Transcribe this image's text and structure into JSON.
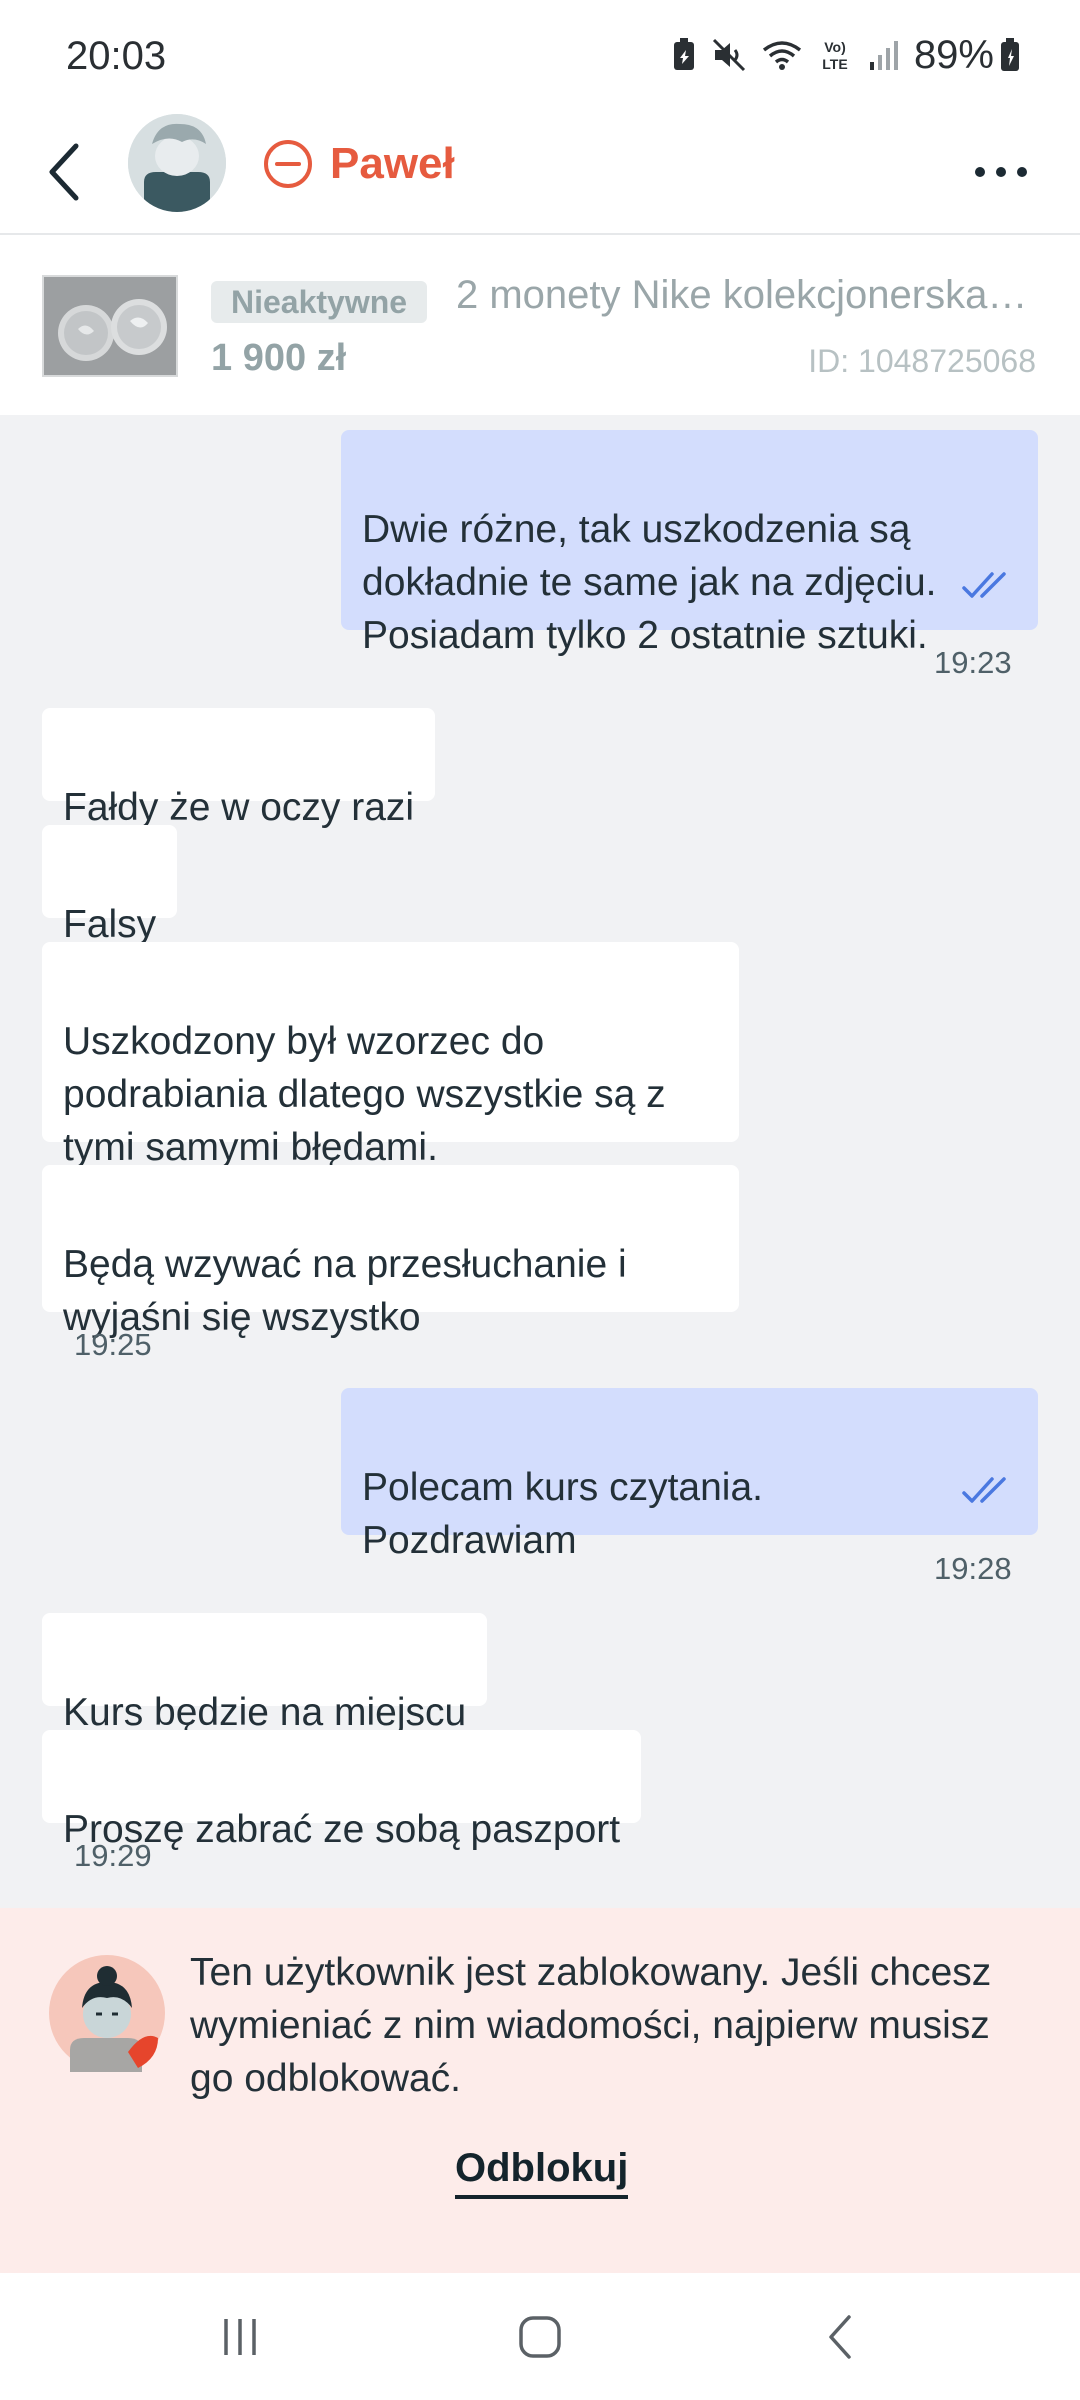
{
  "status_bar": {
    "time": "20:03",
    "battery": "89%",
    "icons": [
      "battery-saver-icon",
      "mute-icon",
      "wifi-icon",
      "volte-icon",
      "signal-icon",
      "battery-icon"
    ]
  },
  "header": {
    "contact_name": "Paweł",
    "back_icon": "chevron-left-icon",
    "status_icon": "blocked-icon",
    "menu_icon": "more-horizontal-icon",
    "accent_color": "#e65b3f"
  },
  "item": {
    "status": "Nieaktywne",
    "title": "2 monety Nike kolekcjonerska 1…",
    "price": "1 900 zł",
    "id": "ID: 1048725068"
  },
  "messages": [
    {
      "direction": "out",
      "text": "Dwie różne, tak uszkodzenia są\ndokładnie te same jak na zdjęciu.\nPosiadam tylko 2 ostatnie sztuki.",
      "read": true
    },
    {
      "direction": "out",
      "time": "19:23"
    },
    {
      "direction": "in",
      "text": "Fałdy że w oczy razi"
    },
    {
      "direction": "in",
      "text": "Falsy"
    },
    {
      "direction": "in",
      "text": "Uszkodzony był wzorzec do\npodrabiania dlatego wszystkie są z\ntymi samymi błędami."
    },
    {
      "direction": "in",
      "text": "Będą wzywać na przesłuchanie i\nwyjaśni się wszystko"
    },
    {
      "direction": "in",
      "time": "19:25"
    },
    {
      "direction": "out",
      "text": "Polecam kurs czytania.\nPozdrawiam",
      "read": true
    },
    {
      "direction": "out",
      "time": "19:28"
    },
    {
      "direction": "in",
      "text": "Kurs będzie na miejscu"
    },
    {
      "direction": "in",
      "text": "Proszę zabrać ze sobą paszport"
    },
    {
      "direction": "in",
      "time": "19:29"
    }
  ],
  "blocked_banner": {
    "text": "Ten użytkownik jest zablokowany. Jeśli chcesz wymieniać z nim wiadomości, najpierw musisz go odblokować.",
    "action": "Odblokuj"
  },
  "navbar": {
    "icons": [
      "recent-apps-icon",
      "home-icon",
      "back-icon"
    ]
  },
  "colors": {
    "outgoing_bubble": "#d3ddfd",
    "incoming_bubble": "#ffffff",
    "chat_background": "#f1f2f4",
    "banner_background": "#fdecea",
    "read_ticks": "#4a78e0"
  }
}
